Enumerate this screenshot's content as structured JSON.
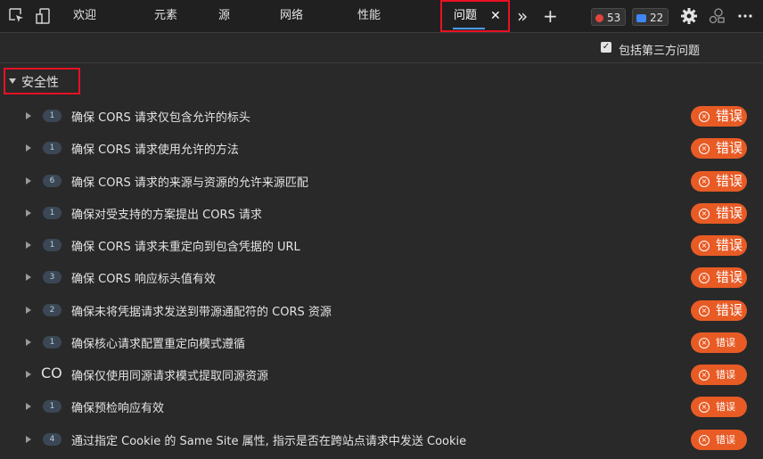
{
  "toolbar": {
    "tabs": [
      "欢迎",
      "元素",
      "源",
      "网络",
      "性能"
    ],
    "active_tab": "问题",
    "close_glyph": "✕",
    "more_glyph": "»",
    "add_glyph": "+",
    "error_count": "53",
    "message_count": "22",
    "icons": [
      "inspect-icon",
      "device-toolbar-icon",
      "settings-icon",
      "customize-icon",
      "more-menu-icon"
    ]
  },
  "filter": {
    "checked": true,
    "check_glyph": "✓",
    "label": "包括第三方问题"
  },
  "section": {
    "title": "安全性"
  },
  "issues": [
    {
      "count": "1",
      "title": "确保 CORS 请求仅包含允许的标头",
      "severity": "错误"
    },
    {
      "count": "1",
      "title": "确保 CORS 请求使用允许的方法",
      "severity": "错误"
    },
    {
      "count": "6",
      "title": "确保 CORS 请求的来源与资源的允许来源匹配",
      "severity": "错误"
    },
    {
      "count": "1",
      "title": "确保对受支持的方案提出 CORS 请求",
      "severity": "错误"
    },
    {
      "count": "1",
      "title": "确保 CORS 请求未重定向到包含凭据的 URL",
      "severity": "错误"
    },
    {
      "count": "3",
      "title": "确保 CORS 响应标头值有效",
      "severity": "错误"
    },
    {
      "count": "2",
      "title": "确保未将凭据请求发送到带源通配符的 CORS 资源",
      "severity": "错误"
    },
    {
      "count": "1",
      "title": "确保核心请求配置重定向模式遵循",
      "severity": "错误"
    },
    {
      "count": "CO",
      "title": "确保仅使用同源请求模式提取同源资源",
      "severity": "错误"
    },
    {
      "count": "1",
      "title": "确保预检响应有效",
      "severity": "错误"
    },
    {
      "count": "4",
      "title": "通过指定 Cookie 的 Same Site 属性, 指示是否在跨站点请求中发送 Cookie",
      "severity": "错误"
    }
  ],
  "colors": {
    "error_pill": "#e85b25",
    "highlight": "#e81123",
    "active_tab_underline": "#4d9df7"
  }
}
